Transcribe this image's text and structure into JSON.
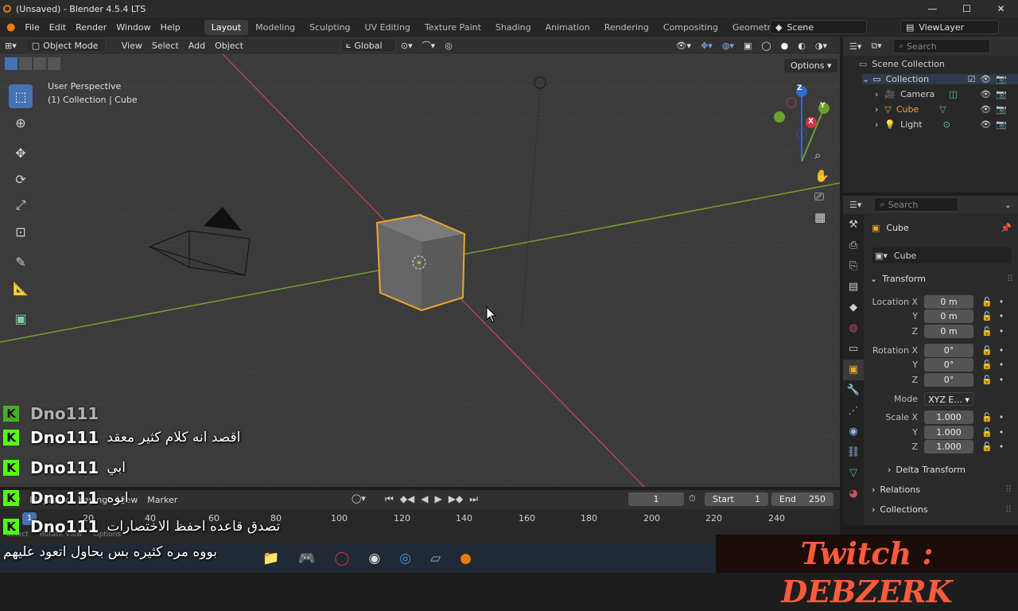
{
  "window": {
    "title": "(Unsaved) - Blender 4.5.4 LTS",
    "controls": [
      "—",
      "☐",
      "✕"
    ]
  },
  "menubar": {
    "menus": [
      "File",
      "Edit",
      "Render",
      "Window",
      "Help"
    ],
    "workspaces": [
      "Layout",
      "Modeling",
      "Sculpting",
      "UV Editing",
      "Texture Paint",
      "Shading",
      "Animation",
      "Rendering",
      "Compositing",
      "Geometry Node"
    ],
    "active_workspace": "Layout",
    "scene": "Scene",
    "view_layer": "ViewLayer"
  },
  "viewport_header": {
    "mode": "Object Mode",
    "menus": [
      "View",
      "Select",
      "Add",
      "Object"
    ],
    "transform_orientation": "Global",
    "options_label": "Options"
  },
  "viewport": {
    "view_name": "User Perspective",
    "context": "(1) Collection | Cube",
    "gizmo_axes": [
      "Z",
      "Y",
      "X"
    ]
  },
  "outliner": {
    "search_placeholder": "Search",
    "root": "Scene Collection",
    "collection": "Collection",
    "items": [
      {
        "name": "Camera",
        "selected": false,
        "color": "#d5d5d5"
      },
      {
        "name": "Cube",
        "selected": true,
        "color": "#f0a52a"
      },
      {
        "name": "Light",
        "selected": false,
        "color": "#d5d5d5"
      }
    ]
  },
  "properties": {
    "search_placeholder": "Search",
    "object_name": "Cube",
    "data_name": "Cube",
    "transform_label": "Transform",
    "location": [
      {
        "label": "Location X",
        "value": "0 m"
      },
      {
        "label": "Y",
        "value": "0 m"
      },
      {
        "label": "Z",
        "value": "0 m"
      }
    ],
    "rotation": [
      {
        "label": "Rotation X",
        "value": "0°"
      },
      {
        "label": "Y",
        "value": "0°"
      },
      {
        "label": "Z",
        "value": "0°"
      }
    ],
    "mode_label": "Mode",
    "mode_value": "XYZ E...",
    "scale": [
      {
        "label": "Scale X",
        "value": "1.000"
      },
      {
        "label": "Y",
        "value": "1.000"
      },
      {
        "label": "Z",
        "value": "1.000"
      }
    ],
    "delta_transform": "Delta Transform",
    "relations": "Relations",
    "collections": "Collections"
  },
  "timeline": {
    "menus": [
      "Playback",
      "Keying",
      "View",
      "Marker"
    ],
    "current_frame": "1",
    "start_label": "Start",
    "start": "1",
    "end_label": "End",
    "end": "250",
    "ruler": [
      "20",
      "40",
      "60",
      "80",
      "100",
      "120",
      "140",
      "160",
      "180",
      "200",
      "220",
      "240"
    ],
    "frame_badge": "1"
  },
  "statusbar": {
    "items": [
      "Select",
      "Rotate View",
      "Options"
    ]
  },
  "chat": [
    {
      "user": "Dno111",
      "message": "اقصد انه كلام كثير معقد"
    },
    {
      "user": "Dno111",
      "message": "ابي"
    },
    {
      "user": "Dno111",
      "message": "ايوه"
    },
    {
      "user": "Dno111",
      "message": "تصدق قاعده احفظ الاختصارات"
    }
  ],
  "chat_overflow": "بووه مره كثيره بس بحاول اتعود عليهم",
  "chat_badge": "K",
  "overlay_brand": "Twitch : DEBZERK",
  "colors": {
    "accent": "#4772b3",
    "selection": "#f0a52a",
    "x_axis": "#c8454f",
    "y_axis": "#7ea82a"
  }
}
